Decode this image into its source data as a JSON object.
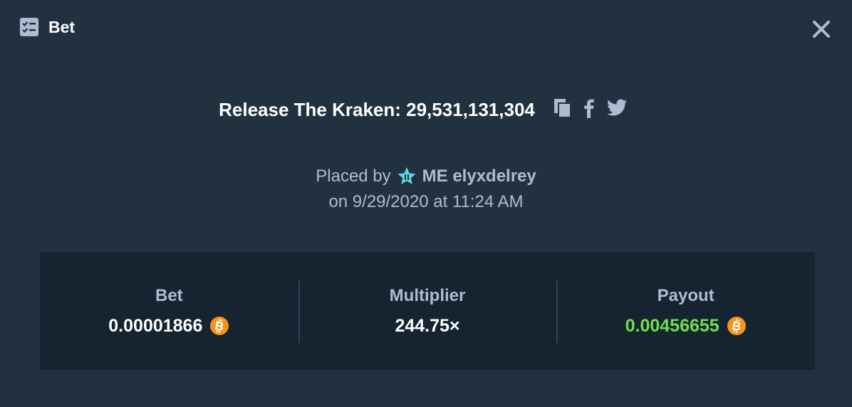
{
  "header": {
    "title": "Bet",
    "icon": "bet-list-icon"
  },
  "close": {
    "icon": "close-icon"
  },
  "game": {
    "title": "Release The Kraken: 29,531,131,304",
    "share_icons": [
      "copy-icon",
      "facebook-icon",
      "twitter-icon"
    ]
  },
  "placed": {
    "prefix": "Placed by",
    "username": "ME elyxdelrey",
    "date_line": "on 9/29/2020 at 11:24 AM"
  },
  "stats": [
    {
      "label": "Bet",
      "value": "0.00001866",
      "currency_icon": "bitcoin-icon"
    },
    {
      "label": "Multiplier",
      "value": "244.75×"
    },
    {
      "label": "Payout",
      "value": "0.00456655",
      "currency_icon": "bitcoin-icon"
    }
  ],
  "colors": {
    "background": "#213140",
    "panel": "#162330",
    "muted_text": "#b1bad3",
    "payout_green": "#6ae247",
    "bitcoin_orange": "#f7931a",
    "vip_star": "#5fd4e8"
  }
}
